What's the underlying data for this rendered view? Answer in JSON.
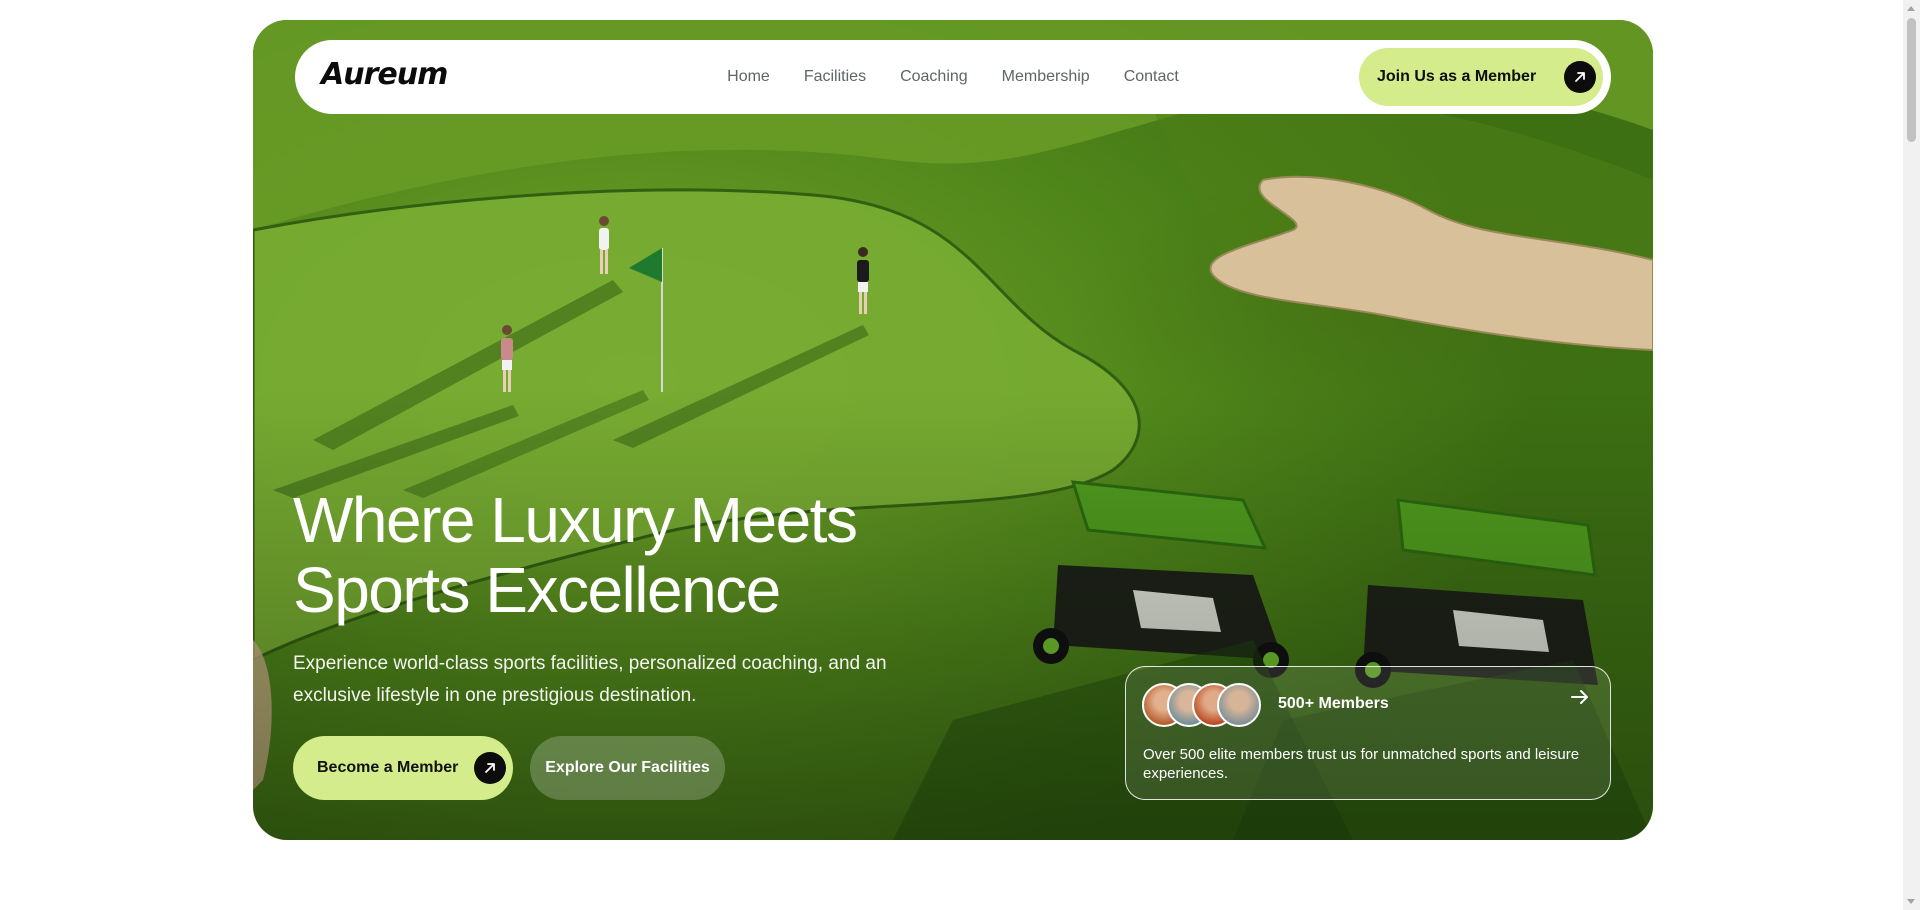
{
  "brand": {
    "name": "Aureum"
  },
  "nav": {
    "links": [
      "Home",
      "Facilities",
      "Coaching",
      "Membership",
      "Contact"
    ],
    "cta_label": "Join Us as a Member"
  },
  "hero": {
    "headline_line1": "Where Luxury Meets",
    "headline_line2": "Sports Excellence",
    "subtext": "Experience world-class sports facilities, personalized coaching, and an exclusive lifestyle in one prestigious destination.",
    "primary_cta": "Become a Member",
    "secondary_cta": "Explore Our Facilities"
  },
  "members_card": {
    "count_label": "500+ Members",
    "description": "Over 500 elite members trust us for unmatched sports and leisure experiences.",
    "avatars": [
      "avatar-1",
      "avatar-2",
      "avatar-3",
      "avatar-4"
    ]
  },
  "colors": {
    "accent": "#d4ec8b",
    "dark": "#0c0c0c",
    "grass": "#5f951f"
  },
  "icons": {
    "cta_arrow": "arrow-up-right-icon",
    "card_arrow": "arrow-right-icon"
  }
}
